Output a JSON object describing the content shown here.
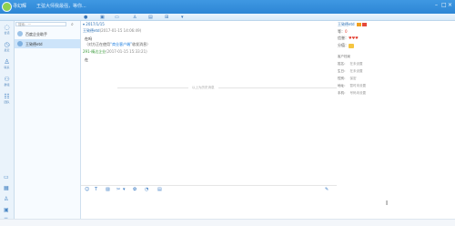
{
  "titlebar": {
    "name": "寻幻辉",
    "status": "王弦大师我最强，等你..."
  },
  "sidebar": {
    "items": [
      {
        "label": "会话",
        "icon": "chat-bubble-icon"
      },
      {
        "label": "最近",
        "icon": "clock-icon"
      },
      {
        "label": "联系",
        "icon": "contacts-icon"
      },
      {
        "label": "群组",
        "icon": "group-icon"
      },
      {
        "label": "团队",
        "icon": "team-icon"
      }
    ]
  },
  "contacts": {
    "search_placeholder": "搜索：一",
    "items": [
      {
        "name": "百度企业助手"
      },
      {
        "name": "王致德etd"
      }
    ]
  },
  "chat": {
    "date": "2017/1/15",
    "messages": [
      {
        "sender": "王致德etd",
        "time": "2017-01-15 14:06:49",
        "lines": [
          "在吗"
        ]
      },
      {
        "system_prefix": "（对方正在使用",
        "system_highlight": "“商业客户端”",
        "system_suffix": "收发消息）"
      },
      {
        "sender": "291-精达企业",
        "time": "2017-01-15 15:33:21",
        "lines": [
          "在"
        ]
      }
    ],
    "divider_text": "以上为历史消息"
  },
  "info_panel": {
    "name": "王致德etd",
    "level_label": "等：",
    "level_value": "0",
    "credit_label": "信誉：",
    "score_label": "分值：",
    "section_title": "客户档案",
    "fields": [
      {
        "label": "姓名：",
        "value": "在未设置"
      },
      {
        "label": "生日：",
        "value": "在未设置"
      },
      {
        "label": "性别：",
        "value": "保密"
      },
      {
        "label": "地址：",
        "value": "暂时未设置"
      },
      {
        "label": "手机：",
        "value": "号码未设置"
      }
    ]
  },
  "colors": {
    "titlebar": "#2d86d5",
    "accent": "#1e7fe0",
    "sender_green": "#3a9a3a"
  }
}
